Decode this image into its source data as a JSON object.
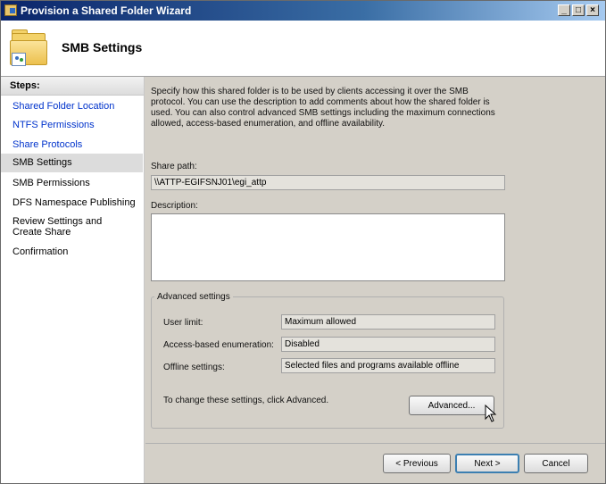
{
  "window": {
    "title": "Provision a Shared Folder Wizard",
    "controls": {
      "minimize": "_",
      "maximize": "□",
      "close": "×"
    }
  },
  "header": {
    "title": "SMB Settings",
    "icon": "shared-folder-icon"
  },
  "steps": {
    "title": "Steps:",
    "items": [
      {
        "label": "Shared Folder Location"
      },
      {
        "label": "NTFS Permissions"
      },
      {
        "label": "Share Protocols"
      },
      {
        "label": "SMB Settings"
      },
      {
        "label": "SMB Permissions"
      },
      {
        "label": "DFS Namespace Publishing"
      },
      {
        "label": "Review Settings and Create Share"
      },
      {
        "label": "Confirmation"
      }
    ],
    "current": "SMB Settings"
  },
  "content": {
    "description": "Specify how this shared folder is to be used by clients accessing it over the SMB protocol. You can use the description to add comments about how the shared folder is used. You can also control advanced SMB settings including the maximum connections allowed, access-based enumeration, and offline availability.",
    "share_path_label": "Share path:",
    "share_path_value": "\\\\ATTP-EGIFSNJ01\\egi_attp",
    "description_label": "Description:",
    "description_value": ""
  },
  "advanced": {
    "title": "Advanced settings",
    "user_limit_label": "User limit:",
    "user_limit_value": "Maximum allowed",
    "abe_label": "Access-based enumeration:",
    "abe_value": "Disabled",
    "offline_label": "Offline settings:",
    "offline_value": "Selected files and programs available offline",
    "hint": "To change these settings, click Advanced.",
    "button": "Advanced..."
  },
  "footer": {
    "previous": "< Previous",
    "next": "Next >",
    "cancel": "Cancel"
  }
}
